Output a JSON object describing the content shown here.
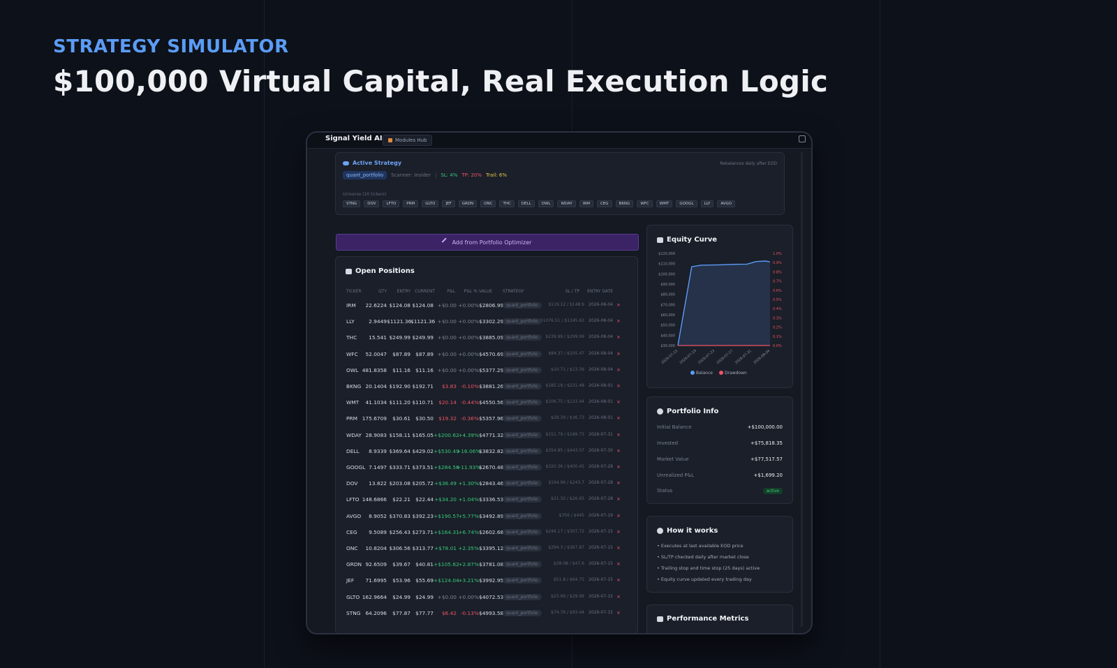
{
  "hero": {
    "eyebrow": "STRATEGY SIMULATOR",
    "title": "$100,000 Virtual Capital, Real Execution Logic"
  },
  "app": {
    "brand": "Signal Yield AI",
    "hub_tab": "Modules Hub"
  },
  "strategy": {
    "title": "Active Strategy",
    "name": "quant_portfolio",
    "scanner": "Scanner: Insider",
    "separator": "|",
    "sl": "SL: 4%",
    "tp": "TP: 20%",
    "trail": "Trail: 6%",
    "rebalance": "Rebalances daily after EOD",
    "universe_label": "Universe (20 tickers)",
    "universe": [
      "STNG",
      "DOV",
      "LFTO",
      "PRM",
      "GLTO",
      "JEF",
      "GRDN",
      "ONC",
      "THC",
      "DELL",
      "OWL",
      "WDAY",
      "IRM",
      "CEG",
      "BKNG",
      "WFC",
      "WMT",
      "GOOGL",
      "LLY",
      "AVGO"
    ]
  },
  "optimizer_button": "Add from Portfolio Optimizer",
  "positions": {
    "title": "Open Positions",
    "headers": [
      "TICKER",
      "QTY",
      "ENTRY",
      "CURRENT",
      "P&L",
      "P&L %",
      "VALUE",
      "STRATEGY",
      "SL / TP",
      "ENTRY DATE"
    ],
    "rows": [
      {
        "ticker": "IRM",
        "qty": "22.6224",
        "entry": "$124.08",
        "current": "$124.08",
        "pnl": "+$0.00",
        "pnlpct": "+0.00%",
        "value": "$2806.99",
        "strategy": "quant_portfolio",
        "sltp": "$119.12 / $148.9",
        "date": "2026-08-04",
        "dir": "flat"
      },
      {
        "ticker": "LLY",
        "qty": "2.9449",
        "entry": "$1121.36",
        "current": "$1121.36",
        "pnl": "+$0.00",
        "pnlpct": "+0.00%",
        "value": "$3302.29",
        "strategy": "quant_portfolio",
        "sltp": "$1076.51 / $1345.63",
        "date": "2026-08-04",
        "dir": "flat"
      },
      {
        "ticker": "THC",
        "qty": "15.541",
        "entry": "$249.99",
        "current": "$249.99",
        "pnl": "+$0.00",
        "pnlpct": "+0.00%",
        "value": "$3885.09",
        "strategy": "quant_portfolio",
        "sltp": "$239.99 / $299.99",
        "date": "2026-08-04",
        "dir": "flat"
      },
      {
        "ticker": "WFC",
        "qty": "52.0047",
        "entry": "$87.89",
        "current": "$87.89",
        "pnl": "+$0.00",
        "pnlpct": "+0.00%",
        "value": "$4570.69",
        "strategy": "quant_portfolio",
        "sltp": "$84.37 / $105.47",
        "date": "2026-08-04",
        "dir": "flat"
      },
      {
        "ticker": "OWL",
        "qty": "481.8358",
        "entry": "$11.16",
        "current": "$11.16",
        "pnl": "+$0.00",
        "pnlpct": "+0.00%",
        "value": "$5377.29",
        "strategy": "quant_portfolio",
        "sltp": "$10.71 / $13.39",
        "date": "2026-08-04",
        "dir": "flat"
      },
      {
        "ticker": "BKNG",
        "qty": "20.1404",
        "entry": "$192.90",
        "current": "$192.71",
        "pnl": "$3.83",
        "pnlpct": "-0.10%",
        "value": "$3881.26",
        "strategy": "quant_portfolio",
        "sltp": "$185.18 / $231.48",
        "date": "2026-08-01",
        "dir": "down"
      },
      {
        "ticker": "WMT",
        "qty": "41.1034",
        "entry": "$111.20",
        "current": "$110.71",
        "pnl": "$20.14",
        "pnlpct": "-0.44%",
        "value": "$4550.56",
        "strategy": "quant_portfolio",
        "sltp": "$106.75 / $133.44",
        "date": "2026-08-01",
        "dir": "down"
      },
      {
        "ticker": "PRM",
        "qty": "175.6709",
        "entry": "$30.61",
        "current": "$30.50",
        "pnl": "$19.32",
        "pnlpct": "-0.36%",
        "value": "$5357.96",
        "strategy": "quant_portfolio",
        "sltp": "$29.39 / $36.73",
        "date": "2026-08-01",
        "dir": "down"
      },
      {
        "ticker": "WDAY",
        "qty": "28.9083",
        "entry": "$158.11",
        "current": "$165.05",
        "pnl": "+$200.62",
        "pnlpct": "+4.39%",
        "value": "$4771.32",
        "strategy": "quant_portfolio",
        "sltp": "$151.79 / $189.73",
        "date": "2026-07-31",
        "dir": "up"
      },
      {
        "ticker": "DELL",
        "qty": "8.9339",
        "entry": "$369.64",
        "current": "$429.02",
        "pnl": "+$530.49",
        "pnlpct": "+16.06%",
        "value": "$3832.82",
        "strategy": "quant_portfolio",
        "sltp": "$354.85 / $443.57",
        "date": "2026-07-30",
        "dir": "up"
      },
      {
        "ticker": "GOOGL",
        "qty": "7.1497",
        "entry": "$333.71",
        "current": "$373.51",
        "pnl": "+$284.56",
        "pnlpct": "+11.93%",
        "value": "$2670.48",
        "strategy": "quant_portfolio",
        "sltp": "$320.36 / $400.45",
        "date": "2026-07-28",
        "dir": "up"
      },
      {
        "ticker": "DOV",
        "qty": "13.822",
        "entry": "$203.08",
        "current": "$205.72",
        "pnl": "+$36.49",
        "pnlpct": "+1.30%",
        "value": "$2843.46",
        "strategy": "quant_portfolio",
        "sltp": "$194.96 / $243.7",
        "date": "2026-07-28",
        "dir": "up"
      },
      {
        "ticker": "LFTO",
        "qty": "148.6866",
        "entry": "$22.21",
        "current": "$22.44",
        "pnl": "+$34.20",
        "pnlpct": "+1.04%",
        "value": "$3336.53",
        "strategy": "quant_portfolio",
        "sltp": "$21.32 / $26.65",
        "date": "2026-07-28",
        "dir": "up"
      },
      {
        "ticker": "AVGO",
        "qty": "8.9052",
        "entry": "$370.83",
        "current": "$392.23",
        "pnl": "+$190.57",
        "pnlpct": "+5.77%",
        "value": "$3492.89",
        "strategy": "quant_portfolio",
        "sltp": "$356 / $445",
        "date": "2026-07-19",
        "dir": "up"
      },
      {
        "ticker": "CEG",
        "qty": "9.5089",
        "entry": "$256.43",
        "current": "$273.71",
        "pnl": "+$164.31",
        "pnlpct": "+6.74%",
        "value": "$2602.68",
        "strategy": "quant_portfolio",
        "sltp": "$246.17 / $307.72",
        "date": "2026-07-15",
        "dir": "up"
      },
      {
        "ticker": "ONC",
        "qty": "10.8204",
        "entry": "$306.56",
        "current": "$313.77",
        "pnl": "+$78.01",
        "pnlpct": "+2.35%",
        "value": "$3395.12",
        "strategy": "quant_portfolio",
        "sltp": "$294.3 / $367.87",
        "date": "2026-07-15",
        "dir": "up"
      },
      {
        "ticker": "GRDN",
        "qty": "92.6509",
        "entry": "$39.67",
        "current": "$40.81",
        "pnl": "+$105.62",
        "pnlpct": "+2.87%",
        "value": "$3781.08",
        "strategy": "quant_portfolio",
        "sltp": "$38.08 / $47.6",
        "date": "2026-07-15",
        "dir": "up"
      },
      {
        "ticker": "JEF",
        "qty": "71.6995",
        "entry": "$53.96",
        "current": "$55.69",
        "pnl": "+$124.04",
        "pnlpct": "+3.21%",
        "value": "$3992.95",
        "strategy": "quant_portfolio",
        "sltp": "$51.8 / $64.75",
        "date": "2026-07-15",
        "dir": "up"
      },
      {
        "ticker": "GLTO",
        "qty": "162.9664",
        "entry": "$24.99",
        "current": "$24.99",
        "pnl": "+$0.00",
        "pnlpct": "+0.00%",
        "value": "$4072.53",
        "strategy": "quant_portfolio",
        "sltp": "$23.99 / $29.99",
        "date": "2026-07-15",
        "dir": "flat"
      },
      {
        "ticker": "STNG",
        "qty": "64.2096",
        "entry": "$77.87",
        "current": "$77.77",
        "pnl": "$6.42",
        "pnlpct": "-0.13%",
        "value": "$4993.58",
        "strategy": "quant_portfolio",
        "sltp": "$74.76 / $93.44",
        "date": "2026-07-15",
        "dir": "down"
      }
    ]
  },
  "equity": {
    "title": "Equity Curve",
    "legend": [
      "Balance",
      "Drawdown"
    ],
    "colors": {
      "balance": "#5b9cf5",
      "drawdown": "#ef5466"
    }
  },
  "chart_data": {
    "type": "line",
    "title": "Equity Curve",
    "x": [
      "2026-07-15",
      "2026-07-19",
      "2026-07-23",
      "2026-07-27",
      "2026-07-31",
      "2026-08-04"
    ],
    "x_tick_labels": [
      "2026-07-15",
      "2026-07-19",
      "2026-07-23",
      "2026-07-27",
      "2026-07-31",
      "2026-08-04"
    ],
    "y_tick_labels": [
      "$120,000",
      "$110,000",
      "$100,000",
      "$90,000",
      "$80,000",
      "$70,000",
      "$60,000",
      "$50,000",
      "$40,000",
      "$30,000"
    ],
    "y2_tick_labels": [
      "1.0%",
      "0.9%",
      "0.8%",
      "0.7%",
      "0.6%",
      "0.5%",
      "0.4%",
      "0.3%",
      "0.2%",
      "0.1%",
      "0.0%"
    ],
    "ylim": [
      30000,
      120000
    ],
    "y2lim": [
      0,
      1
    ],
    "series": [
      {
        "name": "Balance",
        "axis": "left",
        "points": [
          [
            "2026-07-15",
            30000
          ],
          [
            "2026-07-18",
            107000
          ],
          [
            "2026-07-20",
            108500
          ],
          [
            "2026-07-24",
            108800
          ],
          [
            "2026-07-27",
            109300
          ],
          [
            "2026-07-30",
            109500
          ],
          [
            "2026-08-01",
            112000
          ],
          [
            "2026-08-03",
            112500
          ],
          [
            "2026-08-04",
            111700
          ]
        ]
      },
      {
        "name": "Drawdown",
        "axis": "right",
        "points": [
          [
            "2026-07-15",
            0
          ],
          [
            "2026-08-04",
            0
          ]
        ]
      }
    ],
    "legend_position": "bottom",
    "grid": false
  },
  "portfolio_info": {
    "title": "Portfolio Info",
    "rows": [
      {
        "label": "Initial Balance",
        "value": "+$100,000.00"
      },
      {
        "label": "Invested",
        "value": "+$75,818.35"
      },
      {
        "label": "Market Value",
        "value": "+$77,517.57"
      },
      {
        "label": "Unrealized P&L",
        "value": "+$1,699.20"
      }
    ],
    "status_label": "Status",
    "status_value": "active"
  },
  "how_it_works": {
    "title": "How it works",
    "items": [
      "Executes at last available EOD price",
      "SL/TP checked daily after market close",
      "Trailing stop and time stop (25 days) active",
      "Equity curve updated every trading day"
    ]
  },
  "performance": {
    "title": "Performance Metrics"
  }
}
